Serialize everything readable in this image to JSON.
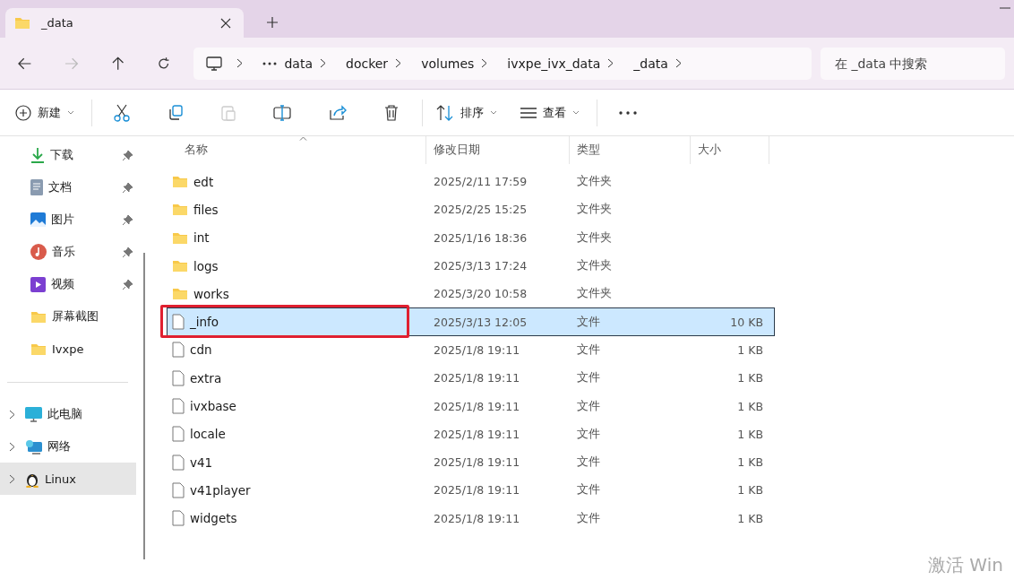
{
  "tabs": [
    {
      "label": "_data",
      "selected": true
    }
  ],
  "nav": {
    "breadcrumb": [
      "data",
      "docker",
      "volumes",
      "ivxpe_ivx_data",
      "_data"
    ],
    "search": {
      "placeholder": "在 _data 中搜索"
    }
  },
  "toolbar": {
    "new": "新建",
    "sort": "排序",
    "view": "查看"
  },
  "sidebar": {
    "quick": [
      {
        "label": "下载",
        "kind": "download",
        "pinned": true
      },
      {
        "label": "文档",
        "kind": "document",
        "pinned": true
      },
      {
        "label": "图片",
        "kind": "pictures",
        "pinned": true
      },
      {
        "label": "音乐",
        "kind": "music",
        "pinned": true
      },
      {
        "label": "视频",
        "kind": "video",
        "pinned": true
      },
      {
        "label": "屏幕截图",
        "kind": "folder",
        "pinned": false
      },
      {
        "label": "Ivxpe",
        "kind": "folder",
        "pinned": false
      }
    ],
    "locations": [
      {
        "label": "此电脑",
        "kind": "pc",
        "selected": false
      },
      {
        "label": "网络",
        "kind": "network",
        "selected": false
      },
      {
        "label": "Linux",
        "kind": "linux",
        "selected": true
      }
    ]
  },
  "table": {
    "columns": [
      "名称",
      "修改日期",
      "类型",
      "大小"
    ],
    "rows": [
      {
        "name": "edt",
        "date": "2025/2/11 17:59",
        "type": "文件夹",
        "kind": "folder",
        "selected": false,
        "highlighted": false
      },
      {
        "name": "files",
        "date": "2025/2/25 15:25",
        "type": "文件夹",
        "kind": "folder",
        "selected": false,
        "highlighted": false
      },
      {
        "name": "int",
        "date": "2025/1/16 18:36",
        "type": "文件夹",
        "kind": "folder",
        "selected": false,
        "highlighted": false
      },
      {
        "name": "logs",
        "date": "2025/3/13 17:24",
        "type": "文件夹",
        "kind": "folder",
        "selected": false,
        "highlighted": false
      },
      {
        "name": "works",
        "date": "2025/3/20 10:58",
        "type": "文件夹",
        "kind": "folder",
        "selected": false,
        "highlighted": false
      },
      {
        "name": "_info",
        "date": "2025/3/13 12:05",
        "type": "文件",
        "size": "10 KB",
        "kind": "file",
        "selected": true,
        "highlighted": true
      },
      {
        "name": "cdn",
        "date": "2025/1/8 19:11",
        "type": "文件",
        "size": "1 KB",
        "kind": "file",
        "selected": false,
        "highlighted": false
      },
      {
        "name": "extra",
        "date": "2025/1/8 19:11",
        "type": "文件",
        "size": "1 KB",
        "kind": "file",
        "selected": false,
        "highlighted": false
      },
      {
        "name": "ivxbase",
        "date": "2025/1/8 19:11",
        "type": "文件",
        "size": "1 KB",
        "kind": "file",
        "selected": false,
        "highlighted": false
      },
      {
        "name": "locale",
        "date": "2025/1/8 19:11",
        "type": "文件",
        "size": "1 KB",
        "kind": "file",
        "selected": false,
        "highlighted": false
      },
      {
        "name": "v41",
        "date": "2025/1/8 19:11",
        "type": "文件",
        "size": "1 KB",
        "kind": "file",
        "selected": false,
        "highlighted": false
      },
      {
        "name": "v41player",
        "date": "2025/1/8 19:11",
        "type": "文件",
        "size": "1 KB",
        "kind": "file",
        "selected": false,
        "highlighted": false
      },
      {
        "name": "widgets",
        "date": "2025/1/8 19:11",
        "type": "文件",
        "size": "1 KB",
        "kind": "file",
        "selected": false,
        "highlighted": false
      }
    ]
  },
  "activation_notice": "激活 Win"
}
